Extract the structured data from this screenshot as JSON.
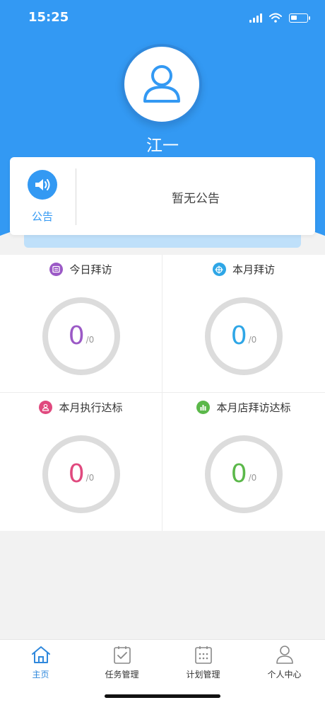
{
  "status_bar": {
    "time": "15:25"
  },
  "profile": {
    "name": "江一",
    "avatar_icon": "user-icon"
  },
  "notice": {
    "label": "公告",
    "text": "暂无公告",
    "icon": "speaker-icon"
  },
  "stats": [
    {
      "title": "今日拜访",
      "value": "0",
      "total": "/0",
      "color": "#9b59c6",
      "icon": "calendar-icon"
    },
    {
      "title": "本月拜访",
      "value": "0",
      "total": "/0",
      "color": "#2ea6e6",
      "icon": "target-icon"
    },
    {
      "title": "本月执行达标",
      "value": "0",
      "total": "/0",
      "color": "#e0497e",
      "icon": "person-icon"
    },
    {
      "title": "本月店拜访达标",
      "value": "0",
      "total": "/0",
      "color": "#5bb84a",
      "icon": "bar-chart-icon"
    }
  ],
  "tabs": [
    {
      "label": "主页",
      "icon": "home-icon",
      "active": true
    },
    {
      "label": "任务管理",
      "icon": "task-icon",
      "active": false
    },
    {
      "label": "计划管理",
      "icon": "calendar-grid-icon",
      "active": false
    },
    {
      "label": "个人中心",
      "icon": "user-icon",
      "active": false
    }
  ],
  "colors": {
    "primary": "#3399f3",
    "background": "#f2f2f2"
  }
}
